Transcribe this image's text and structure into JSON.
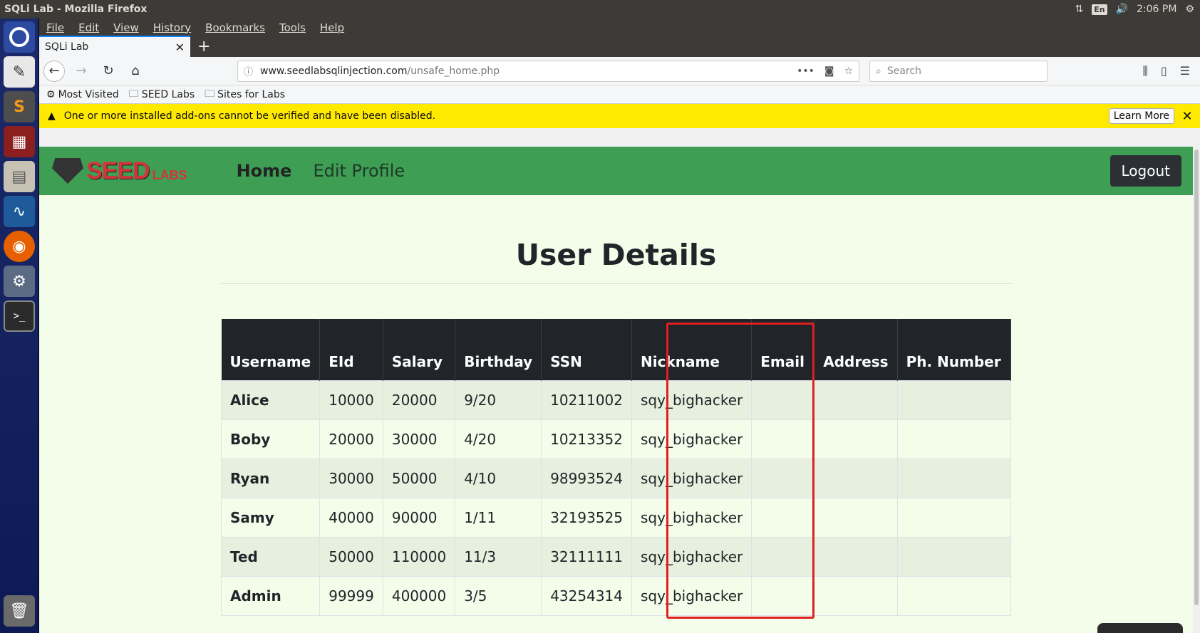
{
  "system": {
    "window_title": "SQLi Lab - Mozilla Firefox",
    "lang": "En",
    "time": "2:06 PM"
  },
  "launcher": {
    "items": [
      "ubuntu-dash-icon",
      "text-editor-icon",
      "sublime-text-icon",
      "red-app-icon",
      "file-manager-icon",
      "wireshark-icon",
      "firefox-icon",
      "settings-icon",
      "terminal-icon",
      "trash-icon"
    ]
  },
  "menubar": {
    "file": "File",
    "edit": "Edit",
    "view": "View",
    "history": "History",
    "bookmarks": "Bookmarks",
    "tools": "Tools",
    "help": "Help"
  },
  "tab": {
    "title": "SQLi Lab",
    "close": "✕"
  },
  "url": {
    "host": "www.seedlabsqlinjection.com",
    "path": "/unsafe_home.php"
  },
  "search": {
    "placeholder": "Search"
  },
  "bookmarks": {
    "most_visited": "Most Visited",
    "seed_labs": "SEED Labs",
    "sites_for_labs": "Sites for Labs"
  },
  "notification": {
    "text": "One or more installed add-ons cannot be verified and have been disabled.",
    "learn_more": "Learn More"
  },
  "site": {
    "logo_seed": "SEED",
    "logo_labs": "LABS",
    "nav_home": "Home",
    "nav_edit_profile": "Edit Profile",
    "logout": "Logout",
    "heading": "User Details"
  },
  "table": {
    "headers": [
      "Username",
      "EId",
      "Salary",
      "Birthday",
      "SSN",
      "Nickname",
      "Email",
      "Address",
      "Ph. Number"
    ],
    "rows": [
      [
        "Alice",
        "10000",
        "20000",
        "9/20",
        "10211002",
        "sqy_bighacker",
        "",
        "",
        ""
      ],
      [
        "Boby",
        "20000",
        "30000",
        "4/20",
        "10213352",
        "sqy_bighacker",
        "",
        "",
        ""
      ],
      [
        "Ryan",
        "30000",
        "50000",
        "4/10",
        "98993524",
        "sqy_bighacker",
        "",
        "",
        ""
      ],
      [
        "Samy",
        "40000",
        "90000",
        "1/11",
        "32193525",
        "sqy_bighacker",
        "",
        "",
        ""
      ],
      [
        "Ted",
        "50000",
        "110000",
        "11/3",
        "32111111",
        "sqy_bighacker",
        "",
        "",
        ""
      ],
      [
        "Admin",
        "99999",
        "400000",
        "3/5",
        "43254314",
        "sqy_bighacker",
        "",
        "",
        ""
      ]
    ]
  },
  "colors": {
    "nav_green": "#3e9f54",
    "page_bg": "#f4fcea",
    "header_dark": "#212529",
    "highlight_box": "#e02020",
    "notification_yellow": "#ffe900"
  }
}
